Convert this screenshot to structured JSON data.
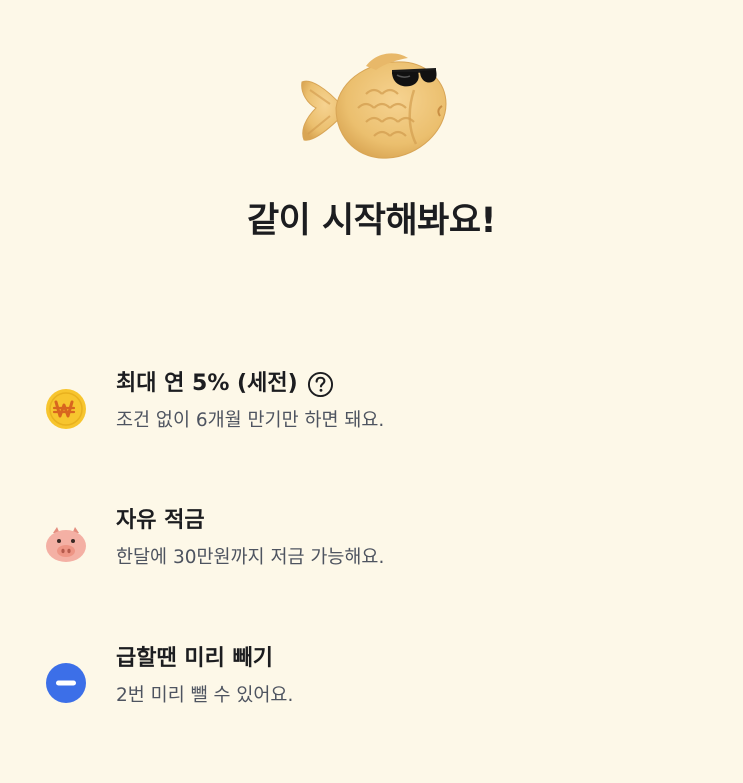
{
  "headline": "같이 시작해봐요!",
  "features": [
    {
      "icon": "won-coin-icon",
      "title": "최대 연 5% (세전)",
      "has_help": true,
      "description": "조건 없이 6개월 만기만 하면 돼요."
    },
    {
      "icon": "piggy-bank-icon",
      "title": "자유 적금",
      "has_help": false,
      "description": "한달에 30만원까지 저금 가능해요."
    },
    {
      "icon": "minus-circle-icon",
      "title": "급할땐 미리 빼기",
      "has_help": false,
      "description": "2번 미리 뺄 수 있어요."
    }
  ],
  "colors": {
    "background": "#fdf8e8",
    "coin": "#f7c52e",
    "piggy": "#f4b0a4",
    "minus": "#3c6fe8"
  }
}
